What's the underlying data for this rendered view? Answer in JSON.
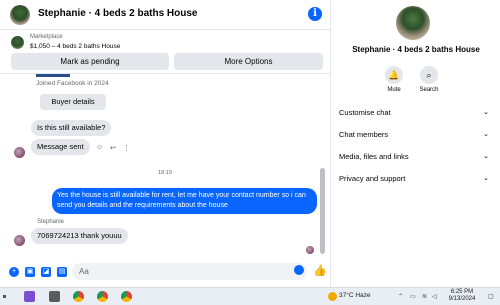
{
  "header": {
    "title": "Stephanie · 4 beds 2 baths House",
    "info_icon": "i"
  },
  "marketplace": {
    "label": "Marketplace",
    "listing": "$1,050 – 4 beds 2 baths House",
    "mark_pending": "Mark as pending",
    "more_options": "More Options"
  },
  "messages": {
    "joined": "Joined Facebook in 2024",
    "buyer_details": "Buyer details",
    "msg1": "Is this still available?",
    "msg2": "Message sent",
    "time": "18:19",
    "outgoing": "Yes the house is still available for rent, let me have your contact number so i can send you details and the requirements about the house",
    "sender": "Stephanie",
    "msg3": "7069724213 thank youuu"
  },
  "composer": {
    "placeholder": "Aa"
  },
  "sidebar": {
    "name": "Stephanie · 4 beds 2 baths House",
    "mute": "Mute",
    "search": "Search",
    "rows": [
      "Customise chat",
      "Chat members",
      "Media, files and links",
      "Privacy and support"
    ]
  },
  "taskbar": {
    "weather": "37°C  Haze",
    "time": "6:25 PM",
    "date": "9/13/2024"
  }
}
